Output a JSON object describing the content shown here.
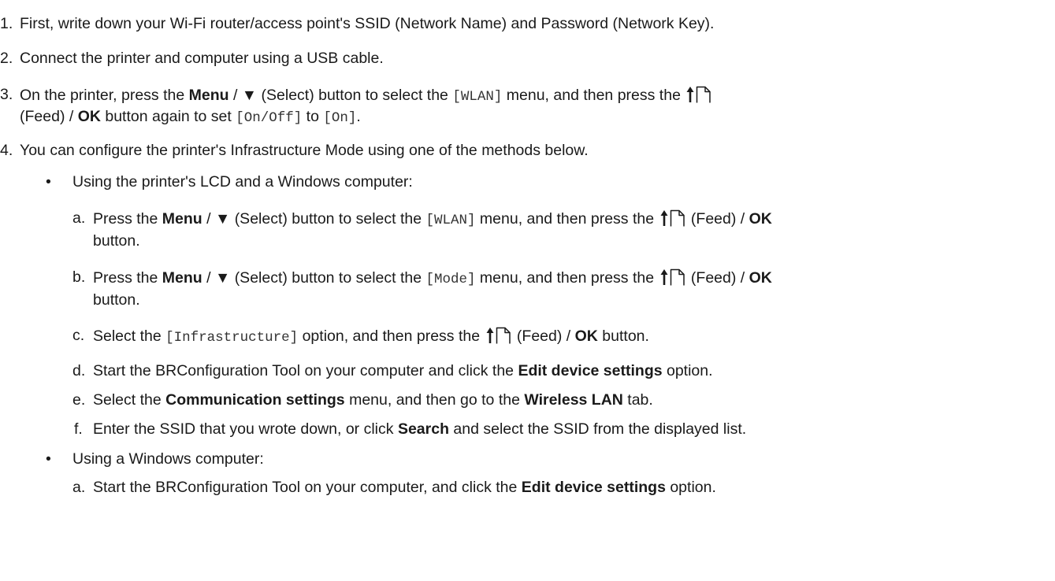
{
  "steps": [
    {
      "num": "1.",
      "text": "First, write down your Wi-Fi router/access point's SSID (Network Name) and Password (Network Key)."
    },
    {
      "num": "2.",
      "text": "Connect the printer and computer using a USB cable."
    },
    {
      "num": "3.",
      "line1": {
        "t1": "On the printer, press the ",
        "menu": "Menu",
        "t2": " / ▼ (Select) button to select the ",
        "code": "[WLAN]",
        "t3": " menu, and then press the "
      },
      "line2": {
        "t1": "(Feed) / ",
        "ok": "OK",
        "t2": " button again to set ",
        "code1": "[On/Off]",
        "t3": " to ",
        "code2": "[On]",
        "t4": "."
      }
    },
    {
      "num": "4.",
      "text": "You can configure the printer's Infrastructure Mode using one of the methods below."
    }
  ],
  "method1": {
    "bullet": "•",
    "title": "Using the printer's LCD and a Windows computer:",
    "a": {
      "letter": "a.",
      "t1": "Press the ",
      "menu": "Menu",
      "t2": " / ▼ (Select) button to select the ",
      "code": "[WLAN]",
      "t3": " menu, and then press the ",
      "t4": " (Feed) / ",
      "ok": "OK",
      "line2": "button."
    },
    "b": {
      "letter": "b.",
      "t1": "Press the ",
      "menu": "Menu",
      "t2": " / ▼ (Select) button to select the ",
      "code": "[Mode]",
      "t3": " menu, and then press the ",
      "t4": " (Feed) / ",
      "ok": "OK",
      "line2": "button."
    },
    "c": {
      "letter": "c.",
      "t1": "Select the ",
      "code": "[Infrastructure]",
      "t2": " option, and then press the ",
      "t3": " (Feed) / ",
      "ok": "OK",
      "t4": " button."
    },
    "d": {
      "letter": "d.",
      "t1": "Start the BRConfiguration Tool on your computer and click the ",
      "bold": "Edit device settings",
      "t2": " option."
    },
    "e": {
      "letter": "e.",
      "t1": "Select the ",
      "bold1": "Communication settings",
      "t2": " menu, and then go to the ",
      "bold2": "Wireless LAN",
      "t3": " tab."
    },
    "f": {
      "letter": "f.",
      "t1": "Enter the SSID that you wrote down, or click ",
      "bold": "Search",
      "t2": " and select the SSID from the displayed list."
    }
  },
  "method2": {
    "bullet": "•",
    "title": "Using a Windows computer:",
    "a": {
      "letter": "a.",
      "t1": "Start the BRConfiguration Tool on your computer, and click the ",
      "bold": "Edit device settings",
      "t2": " option."
    }
  },
  "icons": {
    "feed": "feed-button-icon"
  }
}
